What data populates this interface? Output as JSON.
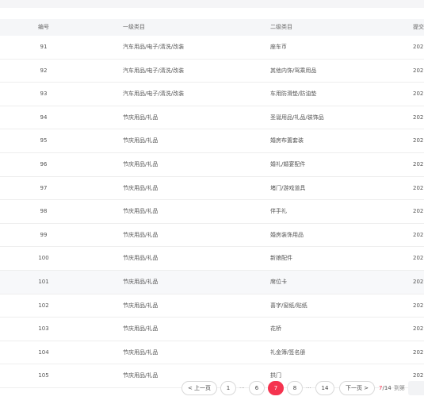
{
  "table": {
    "headers": {
      "id": "编号",
      "cat1": "一级类目",
      "cat2": "二级类目",
      "time": "提交"
    },
    "rows": [
      {
        "id": "91",
        "cat1": "汽车用品/电子/清洗/改装",
        "cat2": "座车币",
        "time": "202"
      },
      {
        "id": "92",
        "cat1": "汽车用品/电子/清洗/改装",
        "cat2": "其他内饰/驾乘用品",
        "time": "202"
      },
      {
        "id": "93",
        "cat1": "汽车用品/电子/清洗/改装",
        "cat2": "车用防滑垫/防油垫",
        "time": "202"
      },
      {
        "id": "94",
        "cat1": "节庆用品/礼品",
        "cat2": "圣诞用品/礼品/装饰品",
        "time": "202"
      },
      {
        "id": "95",
        "cat1": "节庆用品/礼品",
        "cat2": "婚房布置套装",
        "time": "202"
      },
      {
        "id": "96",
        "cat1": "节庆用品/礼品",
        "cat2": "婚礼/婚宴配件",
        "time": "202"
      },
      {
        "id": "97",
        "cat1": "节庆用品/礼品",
        "cat2": "堵门/游戏道具",
        "time": "202"
      },
      {
        "id": "98",
        "cat1": "节庆用品/礼品",
        "cat2": "伴手礼",
        "time": "202"
      },
      {
        "id": "99",
        "cat1": "节庆用品/礼品",
        "cat2": "婚房装饰用品",
        "time": "202"
      },
      {
        "id": "100",
        "cat1": "节庆用品/礼品",
        "cat2": "新娘配件",
        "time": "202"
      },
      {
        "id": "101",
        "cat1": "节庆用品/礼品",
        "cat2": "席位卡",
        "time": "202"
      },
      {
        "id": "102",
        "cat1": "节庆用品/礼品",
        "cat2": "喜字/窗纸/贴纸",
        "time": "202"
      },
      {
        "id": "103",
        "cat1": "节庆用品/礼品",
        "cat2": "花桥",
        "time": "202"
      },
      {
        "id": "104",
        "cat1": "节庆用品/礼品",
        "cat2": "礼金簿/签名册",
        "time": "202"
      },
      {
        "id": "105",
        "cat1": "节庆用品/礼品",
        "cat2": "拱门",
        "time": "202"
      }
    ],
    "highlighted_row": "101"
  },
  "pagination": {
    "prev_label": "< 上一页",
    "next_label": "下一页 >",
    "ellipsis": "···",
    "pages": [
      "1",
      "6",
      "7",
      "8",
      "14"
    ],
    "current_page": "7",
    "current": "7",
    "total_suffix": "/14",
    "goto_label": "到第",
    "accent_color": "#f5334f"
  }
}
